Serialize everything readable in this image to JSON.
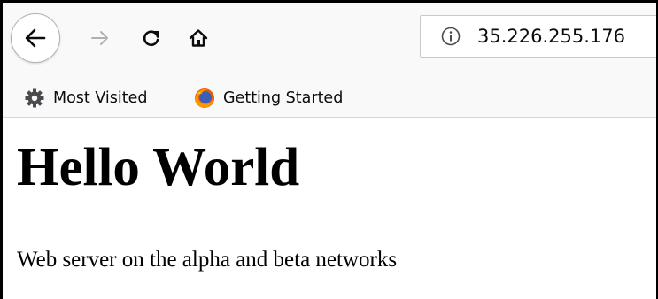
{
  "toolbar": {
    "back_icon": "arrow-left-icon",
    "forward_icon": "arrow-right-icon",
    "reload_icon": "reload-icon",
    "home_icon": "home-icon",
    "urlbar": {
      "info_icon": "info-icon",
      "url": "35.226.255.176"
    }
  },
  "bookmarks": {
    "items": [
      {
        "label": "Most Visited",
        "icon": "gear-icon"
      },
      {
        "label": "Getting Started",
        "icon": "firefox-icon"
      }
    ]
  },
  "page": {
    "heading": "Hello World",
    "paragraph": "Web server on the alpha and beta networks"
  },
  "colors": {
    "toolbar_bg": "#f9f9fa",
    "text": "#0c0c0d",
    "icon": "#0c0c0d",
    "disabled_icon": "#b1b1b3",
    "firefox_orange": "#e66000",
    "firefox_blue": "#3a5db5"
  }
}
